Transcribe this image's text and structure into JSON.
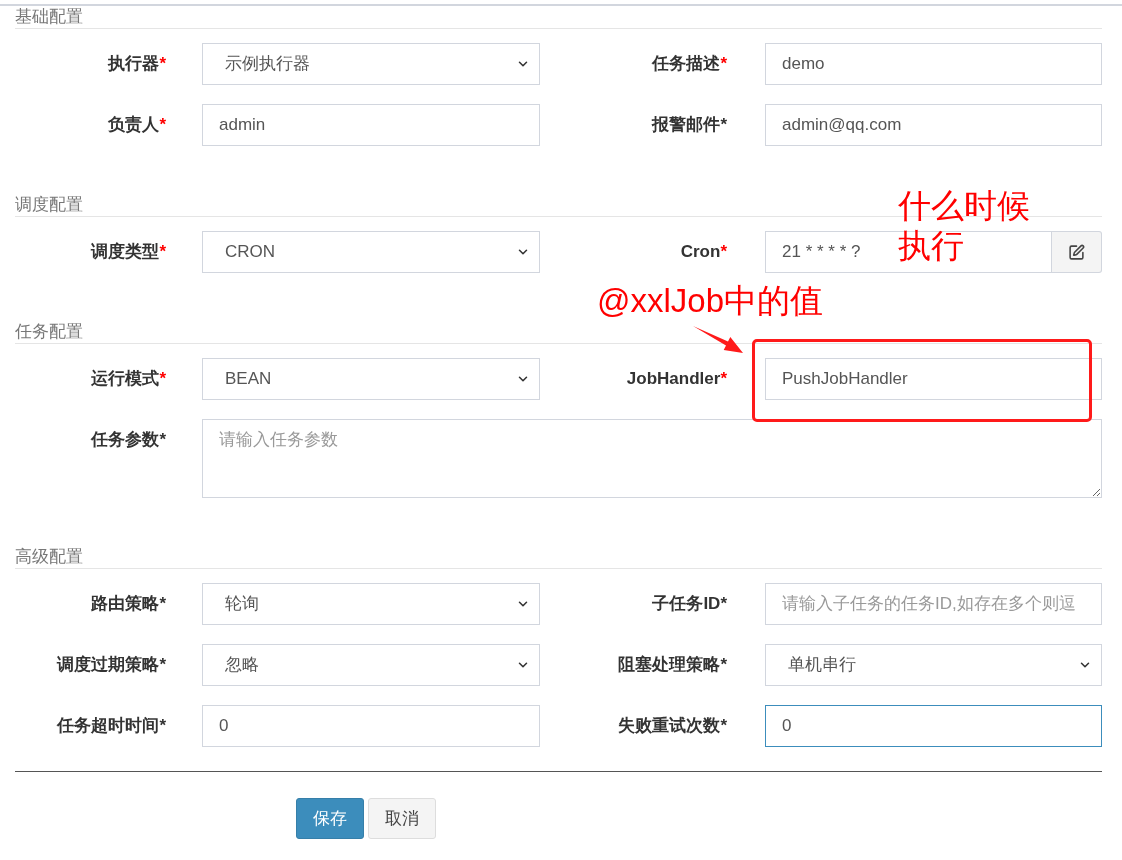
{
  "sections": [
    {
      "title": "基础配置",
      "rows": [
        {
          "fields": [
            {
              "label": "执行器",
              "required_mark": {
                "text": "*",
                "color": "#ff0000"
              },
              "kind": "select",
              "value": "示例执行器",
              "focused": false
            },
            {
              "label": "任务描述",
              "required_mark": {
                "text": "*",
                "color": "#ff0000"
              },
              "kind": "input",
              "value": "demo",
              "focused": false
            }
          ]
        },
        {
          "fields": [
            {
              "label": "负责人",
              "required_mark": {
                "text": "*",
                "color": "#ff0000"
              },
              "kind": "input",
              "value": "admin",
              "focused": false
            },
            {
              "label": "报警邮件",
              "required_mark": {
                "text": "*",
                "color": "#333333"
              },
              "kind": "input",
              "value": "admin@qq.com",
              "focused": false
            }
          ]
        }
      ]
    },
    {
      "title": "调度配置",
      "rows": [
        {
          "fields": [
            {
              "label": "调度类型",
              "required_mark": {
                "text": "*",
                "color": "#ff0000"
              },
              "kind": "select",
              "value": "CRON",
              "focused": false
            },
            {
              "label": "Cron",
              "required_mark": {
                "text": "*",
                "color": "#ff0000"
              },
              "kind": "input_button",
              "value": "21 * * * * ?",
              "focused": false
            }
          ]
        }
      ]
    },
    {
      "title": "任务配置",
      "rows": [
        {
          "fields": [
            {
              "label": "运行模式",
              "required_mark": {
                "text": "*",
                "color": "#ff0000"
              },
              "kind": "select",
              "value": "BEAN",
              "focused": false
            },
            {
              "label": "JobHandler",
              "required_mark": {
                "text": "*",
                "color": "#ff0000"
              },
              "kind": "input",
              "value": "PushJobHandler",
              "focused": false
            }
          ]
        },
        {
          "fields": [
            {
              "label": "任务参数",
              "required_mark": {
                "text": "*",
                "color": "#333333"
              },
              "kind": "textarea",
              "placeholder": "请输入任务参数",
              "focused": false
            }
          ]
        }
      ]
    },
    {
      "title": "高级配置",
      "rows": [
        {
          "fields": [
            {
              "label": "路由策略",
              "required_mark": {
                "text": "*",
                "color": "#333333"
              },
              "kind": "select",
              "value": "轮询",
              "focused": false
            },
            {
              "label": "子任务ID",
              "required_mark": {
                "text": "*",
                "color": "#333333"
              },
              "kind": "input",
              "placeholder": "请输入子任务的任务ID,如存在多个则逗",
              "focused": false
            }
          ]
        },
        {
          "fields": [
            {
              "label": "调度过期策略",
              "required_mark": {
                "text": "*",
                "color": "#333333"
              },
              "kind": "select",
              "value": "忽略",
              "focused": false
            },
            {
              "label": "阻塞处理策略",
              "required_mark": {
                "text": "*",
                "color": "#333333"
              },
              "kind": "select",
              "value": "单机串行",
              "focused": false
            }
          ]
        },
        {
          "fields": [
            {
              "label": "任务超时时间",
              "required_mark": {
                "text": "*",
                "color": "#333333"
              },
              "kind": "input",
              "value": "0",
              "focused": false
            },
            {
              "label": "失败重试次数",
              "required_mark": {
                "text": "*",
                "color": "#333333"
              },
              "kind": "input",
              "value": "0",
              "focused": true
            }
          ]
        }
      ]
    }
  ],
  "buttons": [
    {
      "label": "保存",
      "kind": "primary"
    },
    {
      "label": "取消",
      "kind": "default"
    }
  ],
  "annotations": [
    {
      "kind": "note",
      "text": "什么时候执行"
    },
    {
      "kind": "callout",
      "text": "@xxlJob中的值"
    }
  ]
}
